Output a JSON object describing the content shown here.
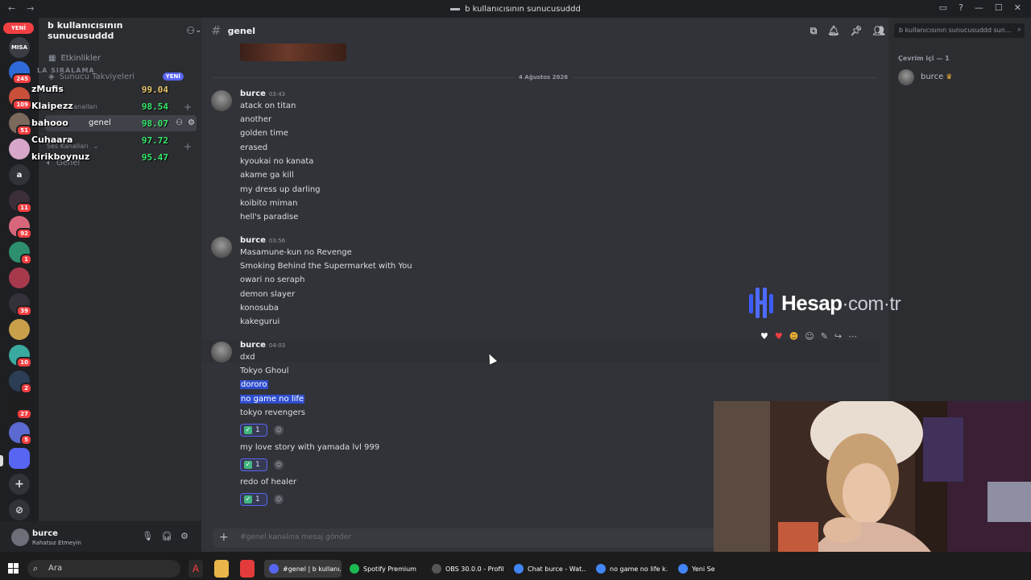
{
  "window": {
    "title": "b kullanıcısının sunucusuddd"
  },
  "servers": {
    "new_badge": "YENİ",
    "letter_item": "a",
    "badges": [
      "245",
      "109",
      "51",
      "11",
      "92",
      "1",
      "39",
      "10",
      "2",
      "27",
      "5"
    ]
  },
  "channels": {
    "server_name": "b kullanıcısının sunucusuddd",
    "events": "Etkinlikler",
    "boosts": "Sunucu Takviyeleri",
    "new_label": "YENİ",
    "text_category": "Kanalları",
    "text_channel": "genel",
    "voice_category": "Ses Kanalları",
    "voice_channel": "Genel"
  },
  "overlay": {
    "title": "LA SIRALAMA",
    "rows": [
      {
        "name": "zMufis",
        "score": "99.04",
        "color": "#e8c76a"
      },
      {
        "name": "Klaipezz",
        "score": "98.54",
        "color": "#35e86b"
      },
      {
        "name": "bahooo",
        "score": "98.07",
        "color": "#35e86b"
      },
      {
        "name": "Cuhaara",
        "score": "97.72",
        "color": "#35e86b"
      },
      {
        "name": "kirikboynuz",
        "score": "95.47",
        "color": "#35e86b"
      }
    ]
  },
  "user_panel": {
    "name": "burce",
    "status": "Rahatsız Etmeyin"
  },
  "chat": {
    "channel": "genel",
    "date_divider": "4 Ağustos 2026",
    "groups": [
      {
        "author": "burce",
        "time": "03:43",
        "lines": [
          "atack on titan",
          "another",
          "golden time",
          "erased",
          "kyoukai no kanata",
          "akame ga kill",
          "my dress up darling",
          "koibito miman",
          "hell's paradise"
        ]
      },
      {
        "author": "burce",
        "time": "03:56",
        "lines": [
          "Masamune-kun no Revenge",
          "Smoking Behind the Supermarket with You",
          "owari no seraph",
          "demon slayer",
          "konosuba",
          "kakegurui"
        ]
      },
      {
        "author": "burce",
        "time": "04:03",
        "lines": [
          "dxd",
          "Tokyo Ghoul",
          "dororo",
          "no game no life",
          "tokyo revengers",
          "my love story with yamada lvl 999",
          "redo of healer"
        ]
      }
    ],
    "reaction_count": "1",
    "composer_placeholder": "#genel kanalına mesaj gönder",
    "search_placeholder": "b kullanıcısının sunucusuddd sun..."
  },
  "members": {
    "header": "Çevrim içi — 1",
    "member": "burce"
  },
  "watermark": {
    "bold": "Hesap",
    "rest": "·com·tr"
  },
  "webcam": {
    "text": " "
  },
  "taskbar": {
    "search": "Ara",
    "tasks": [
      {
        "label": "#genel | b kullanı...",
        "color": "#5865f2"
      },
      {
        "label": "Spotify Premium",
        "color": "#1db954"
      },
      {
        "label": "OBS 30.0.0 - Profil...",
        "color": "#555555"
      },
      {
        "label": "Chat burce - Wat...",
        "color": "#4285f4"
      },
      {
        "label": "no game no life k...",
        "color": "#4285f4"
      },
      {
        "label": "Yeni Sekr",
        "color": "#4285f4"
      }
    ]
  }
}
